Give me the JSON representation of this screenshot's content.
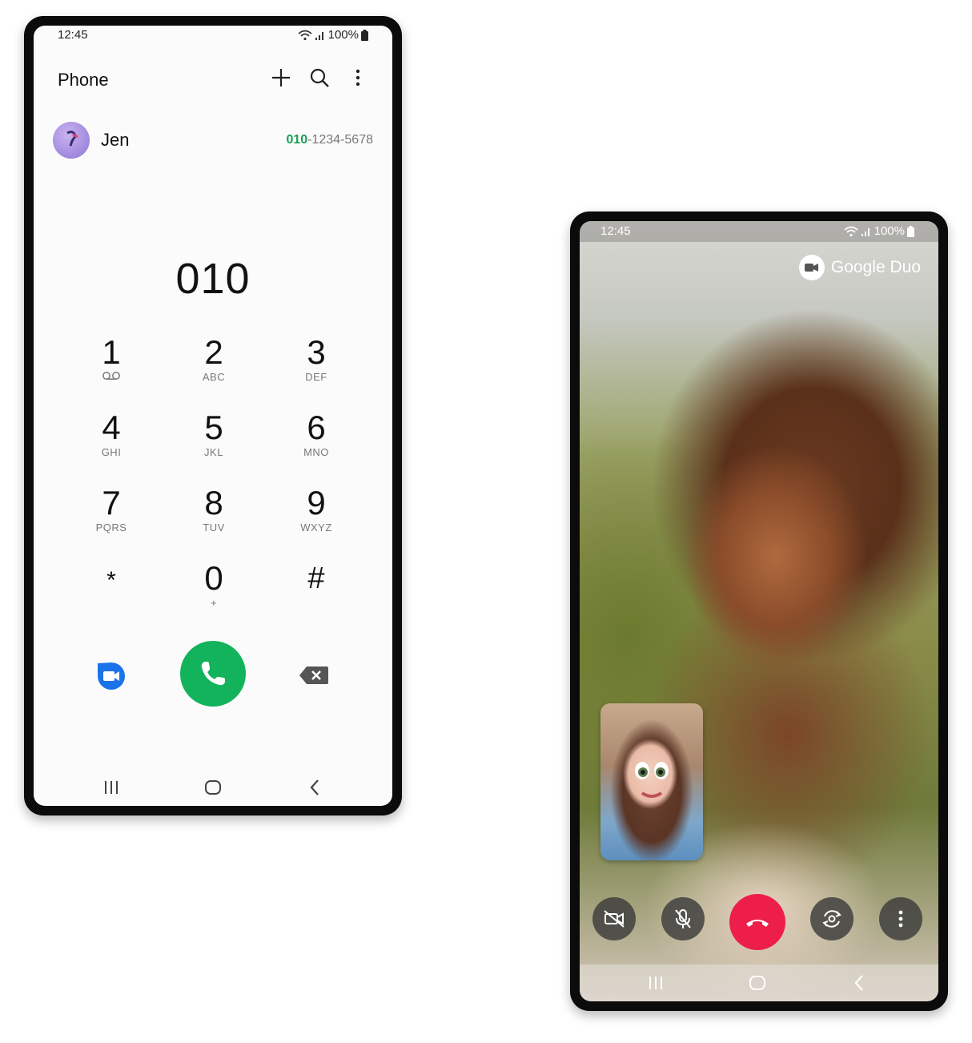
{
  "dialer": {
    "status": {
      "time": "12:45",
      "battery": "100%"
    },
    "title": "Phone",
    "toolbar_icons": [
      "add-icon",
      "search-icon",
      "more-vert-icon"
    ],
    "suggestion": {
      "name": "Jen",
      "number_match": "010",
      "number_rest": "-1234-5678"
    },
    "typed_number": "010",
    "keys": [
      {
        "digit": "1",
        "letters": ""
      },
      {
        "digit": "2",
        "letters": "ABC"
      },
      {
        "digit": "3",
        "letters": "DEF"
      },
      {
        "digit": "4",
        "letters": "GHI"
      },
      {
        "digit": "5",
        "letters": "JKL"
      },
      {
        "digit": "6",
        "letters": "MNO"
      },
      {
        "digit": "7",
        "letters": "PQRS"
      },
      {
        "digit": "8",
        "letters": "TUV"
      },
      {
        "digit": "9",
        "letters": "WXYZ"
      },
      {
        "digit": "*",
        "letters": ""
      },
      {
        "digit": "0",
        "letters": "+"
      },
      {
        "digit": "#",
        "letters": ""
      }
    ],
    "colors": {
      "call_green": "#13b35b",
      "duo_blue": "#1a73e8",
      "match_green": "#1a9e57"
    }
  },
  "video_call": {
    "status": {
      "time": "12:45",
      "battery": "100%"
    },
    "brand": "Google Duo",
    "controls": [
      "video-off-icon",
      "mute-mic-icon",
      "end-call-icon",
      "switch-camera-icon",
      "more-vert-icon"
    ],
    "colors": {
      "end_call_red": "#ee1e4a"
    }
  }
}
